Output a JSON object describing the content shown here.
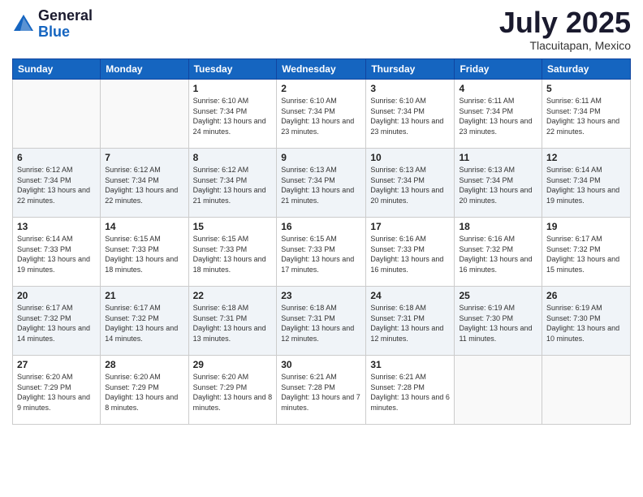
{
  "header": {
    "logo_general": "General",
    "logo_blue": "Blue",
    "month": "July 2025",
    "location": "Tlacuitapan, Mexico"
  },
  "days_of_week": [
    "Sunday",
    "Monday",
    "Tuesday",
    "Wednesday",
    "Thursday",
    "Friday",
    "Saturday"
  ],
  "weeks": [
    [
      {
        "day": "",
        "info": ""
      },
      {
        "day": "",
        "info": ""
      },
      {
        "day": "1",
        "info": "Sunrise: 6:10 AM\nSunset: 7:34 PM\nDaylight: 13 hours and 24 minutes."
      },
      {
        "day": "2",
        "info": "Sunrise: 6:10 AM\nSunset: 7:34 PM\nDaylight: 13 hours and 23 minutes."
      },
      {
        "day": "3",
        "info": "Sunrise: 6:10 AM\nSunset: 7:34 PM\nDaylight: 13 hours and 23 minutes."
      },
      {
        "day": "4",
        "info": "Sunrise: 6:11 AM\nSunset: 7:34 PM\nDaylight: 13 hours and 23 minutes."
      },
      {
        "day": "5",
        "info": "Sunrise: 6:11 AM\nSunset: 7:34 PM\nDaylight: 13 hours and 22 minutes."
      }
    ],
    [
      {
        "day": "6",
        "info": "Sunrise: 6:12 AM\nSunset: 7:34 PM\nDaylight: 13 hours and 22 minutes."
      },
      {
        "day": "7",
        "info": "Sunrise: 6:12 AM\nSunset: 7:34 PM\nDaylight: 13 hours and 22 minutes."
      },
      {
        "day": "8",
        "info": "Sunrise: 6:12 AM\nSunset: 7:34 PM\nDaylight: 13 hours and 21 minutes."
      },
      {
        "day": "9",
        "info": "Sunrise: 6:13 AM\nSunset: 7:34 PM\nDaylight: 13 hours and 21 minutes."
      },
      {
        "day": "10",
        "info": "Sunrise: 6:13 AM\nSunset: 7:34 PM\nDaylight: 13 hours and 20 minutes."
      },
      {
        "day": "11",
        "info": "Sunrise: 6:13 AM\nSunset: 7:34 PM\nDaylight: 13 hours and 20 minutes."
      },
      {
        "day": "12",
        "info": "Sunrise: 6:14 AM\nSunset: 7:34 PM\nDaylight: 13 hours and 19 minutes."
      }
    ],
    [
      {
        "day": "13",
        "info": "Sunrise: 6:14 AM\nSunset: 7:33 PM\nDaylight: 13 hours and 19 minutes."
      },
      {
        "day": "14",
        "info": "Sunrise: 6:15 AM\nSunset: 7:33 PM\nDaylight: 13 hours and 18 minutes."
      },
      {
        "day": "15",
        "info": "Sunrise: 6:15 AM\nSunset: 7:33 PM\nDaylight: 13 hours and 18 minutes."
      },
      {
        "day": "16",
        "info": "Sunrise: 6:15 AM\nSunset: 7:33 PM\nDaylight: 13 hours and 17 minutes."
      },
      {
        "day": "17",
        "info": "Sunrise: 6:16 AM\nSunset: 7:33 PM\nDaylight: 13 hours and 16 minutes."
      },
      {
        "day": "18",
        "info": "Sunrise: 6:16 AM\nSunset: 7:32 PM\nDaylight: 13 hours and 16 minutes."
      },
      {
        "day": "19",
        "info": "Sunrise: 6:17 AM\nSunset: 7:32 PM\nDaylight: 13 hours and 15 minutes."
      }
    ],
    [
      {
        "day": "20",
        "info": "Sunrise: 6:17 AM\nSunset: 7:32 PM\nDaylight: 13 hours and 14 minutes."
      },
      {
        "day": "21",
        "info": "Sunrise: 6:17 AM\nSunset: 7:32 PM\nDaylight: 13 hours and 14 minutes."
      },
      {
        "day": "22",
        "info": "Sunrise: 6:18 AM\nSunset: 7:31 PM\nDaylight: 13 hours and 13 minutes."
      },
      {
        "day": "23",
        "info": "Sunrise: 6:18 AM\nSunset: 7:31 PM\nDaylight: 13 hours and 12 minutes."
      },
      {
        "day": "24",
        "info": "Sunrise: 6:18 AM\nSunset: 7:31 PM\nDaylight: 13 hours and 12 minutes."
      },
      {
        "day": "25",
        "info": "Sunrise: 6:19 AM\nSunset: 7:30 PM\nDaylight: 13 hours and 11 minutes."
      },
      {
        "day": "26",
        "info": "Sunrise: 6:19 AM\nSunset: 7:30 PM\nDaylight: 13 hours and 10 minutes."
      }
    ],
    [
      {
        "day": "27",
        "info": "Sunrise: 6:20 AM\nSunset: 7:29 PM\nDaylight: 13 hours and 9 minutes."
      },
      {
        "day": "28",
        "info": "Sunrise: 6:20 AM\nSunset: 7:29 PM\nDaylight: 13 hours and 8 minutes."
      },
      {
        "day": "29",
        "info": "Sunrise: 6:20 AM\nSunset: 7:29 PM\nDaylight: 13 hours and 8 minutes."
      },
      {
        "day": "30",
        "info": "Sunrise: 6:21 AM\nSunset: 7:28 PM\nDaylight: 13 hours and 7 minutes."
      },
      {
        "day": "31",
        "info": "Sunrise: 6:21 AM\nSunset: 7:28 PM\nDaylight: 13 hours and 6 minutes."
      },
      {
        "day": "",
        "info": ""
      },
      {
        "day": "",
        "info": ""
      }
    ]
  ]
}
